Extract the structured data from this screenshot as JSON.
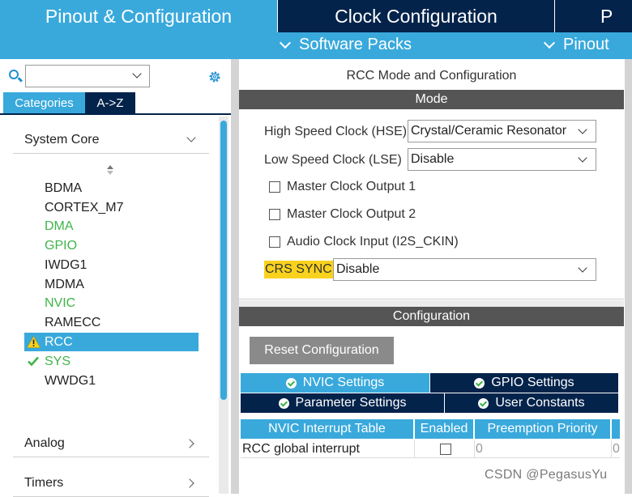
{
  "top_tabs": {
    "pinout_config": "Pinout & Configuration",
    "clock_config": "Clock Configuration",
    "third_partial": "P"
  },
  "sub_bar": {
    "software_packs": "Software Packs",
    "pinout": "Pinout"
  },
  "left": {
    "search_value": "",
    "category_tabs": [
      "Categories",
      "A->Z"
    ],
    "groups": {
      "system_core": "System Core",
      "analog": "Analog",
      "timers": "Timers"
    },
    "items": [
      {
        "label": "BDMA",
        "state": "normal"
      },
      {
        "label": "CORTEX_M7",
        "state": "normal"
      },
      {
        "label": "DMA",
        "state": "green"
      },
      {
        "label": "GPIO",
        "state": "green"
      },
      {
        "label": "IWDG1",
        "state": "normal"
      },
      {
        "label": "MDMA",
        "state": "normal"
      },
      {
        "label": "NVIC",
        "state": "green"
      },
      {
        "label": "RAMECC",
        "state": "normal"
      },
      {
        "label": "RCC",
        "state": "selected-warning"
      },
      {
        "label": "SYS",
        "state": "green-check"
      },
      {
        "label": "WWDG1",
        "state": "normal"
      }
    ]
  },
  "right": {
    "title": "RCC Mode and Configuration",
    "mode_header": "Mode",
    "hse_label": "High Speed Clock (HSE)",
    "hse_value": "Crystal/Ceramic Resonator",
    "lse_label": "Low Speed Clock (LSE)",
    "lse_value": "Disable",
    "checkboxes": [
      "Master Clock Output 1",
      "Master Clock Output 2",
      "Audio Clock Input (I2S_CKIN)"
    ],
    "crs_label": "CRS SYNC",
    "crs_value": "Disable",
    "config_header": "Configuration",
    "reset_button": "Reset Configuration",
    "config_tabs": [
      "NVIC Settings",
      "GPIO Settings",
      "Parameter Settings",
      "User Constants"
    ],
    "table": {
      "headers": [
        "NVIC Interrupt Table",
        "Enabled",
        "Preemption Priority"
      ],
      "row": {
        "name": "RCC global interrupt",
        "preemption": "0",
        "sub": "0"
      }
    }
  },
  "watermark": "CSDN @PegasusYu",
  "colors": {
    "accent_blue": "#39a9dc",
    "dark_navy": "#03234b",
    "highlight_yellow": "#f9d21e",
    "ok_green": "#3fb44a",
    "section_gray": "#555555"
  }
}
